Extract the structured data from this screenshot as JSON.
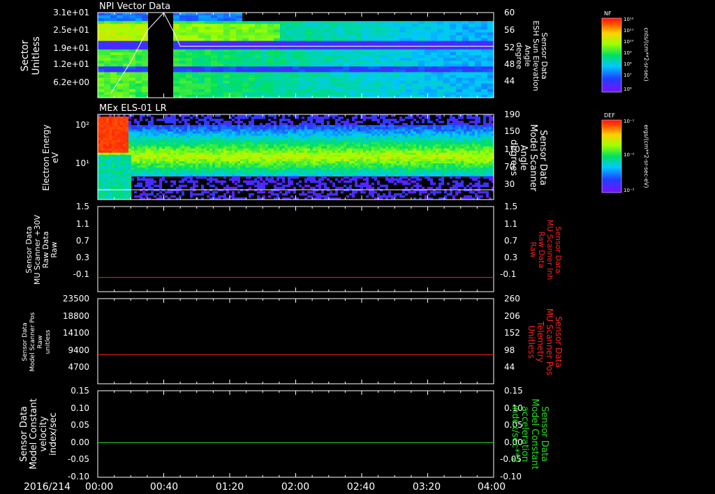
{
  "date_label": "2016/214",
  "time_ticks": [
    "00:00",
    "00:40",
    "01:20",
    "02:00",
    "02:40",
    "03:20",
    "04:00"
  ],
  "colors": {
    "background": "#000000",
    "axis": "#ffffff",
    "red_trace": "#ff2020",
    "green_trace": "#20e020",
    "red_label": "#ff2020",
    "green_label": "#20e020"
  },
  "panels": [
    {
      "title": "NPI Vector Data",
      "left_label": [
        "Sector",
        "Unitless"
      ],
      "left_ticks": [
        "3.1e+01",
        "2.5e+01",
        "1.9e+01",
        "1.2e+01",
        "6.2e+00"
      ],
      "right_label": [
        "Sensor Data",
        "ESH Sun Elevation",
        "Angle",
        "degree"
      ],
      "right_ticks": [
        "60",
        "56",
        "52",
        "48",
        "44"
      ],
      "colorbar": {
        "title": "NF",
        "label": "cnts/(cm**2-sr-sec)",
        "ticks": [
          "10¹²",
          "10¹¹",
          "10¹⁰",
          "10⁹",
          "10⁸",
          "10⁷",
          "10⁶"
        ]
      }
    },
    {
      "title": "MEx ELS-01 LR",
      "left_label": [
        "Electron Energy",
        "eV"
      ],
      "left_ticks": [
        "10²",
        "10¹"
      ],
      "right_label": [
        "Sensor Data",
        "Model Scanner",
        "Angle",
        "degrees"
      ],
      "right_ticks": [
        "190",
        "150",
        "110",
        "70",
        "30"
      ],
      "colorbar": {
        "title": "DEF",
        "label": "ergs/(cm**2-sr-sec-eV)",
        "ticks": [
          "10⁻¹",
          "10⁻²",
          "10⁻³"
        ]
      }
    },
    {
      "left_label": [
        "Sensor Data",
        "MU Scanner +30V",
        "Raw Data",
        "Raw"
      ],
      "left_ticks": [
        "1.5",
        "1.1",
        "0.7",
        "0.3",
        "-0.1"
      ],
      "right_label": [
        "Sensor Data",
        "MU Scanner Inh",
        "Raw Data",
        "Raw"
      ],
      "right_ticks": [
        "1.5",
        "1.1",
        "0.7",
        "0.3",
        "-0.1"
      ]
    },
    {
      "left_label": [
        "Sensor Data",
        "Model Scanner Pos",
        "Raw",
        "unitless"
      ],
      "left_ticks": [
        "23500",
        "18800",
        "14100",
        "9400",
        "4700"
      ],
      "right_label": [
        "Sensor Data",
        "MU Scanner Pos",
        "Telemetry",
        "Unitless"
      ],
      "right_ticks": [
        "260",
        "206",
        "152",
        "98",
        "44"
      ]
    },
    {
      "left_label": [
        "Sensor Data",
        "Model Constant",
        "velocity",
        "index/sec"
      ],
      "left_ticks": [
        "0.15",
        "0.10",
        "0.05",
        "0.00",
        "-0.05",
        "-0.10"
      ],
      "right_label": [
        "Sensor Data",
        "Model Constant",
        "acceleration",
        "index/sec**2"
      ],
      "right_ticks": [
        "0.15",
        "0.10",
        "0.05",
        "0.00",
        "-0.05",
        "-0.10"
      ]
    }
  ],
  "chart_data": [
    {
      "type": "heatmap",
      "title": "NPI Vector Data",
      "x_range": [
        "00:00",
        "04:00"
      ],
      "ylabel": "Sector Unitless",
      "ylim": [
        0,
        31
      ],
      "y2label": "Sensor Data ESH Sun Elevation Angle degree",
      "y2lim": [
        41,
        60
      ],
      "gap": {
        "start": "00:32",
        "end": "00:47"
      },
      "sun_elevation_series": {
        "x": [
          "00:08",
          "00:20",
          "00:30",
          "00:40",
          "00:47",
          "00:50",
          "04:00"
        ],
        "y": [
          42,
          49,
          56,
          60,
          55,
          52.5,
          52.5
        ]
      }
    },
    {
      "type": "heatmap",
      "title": "MEx ELS-01 LR",
      "x_range": [
        "00:00",
        "04:00"
      ],
      "ylabel": "Electron Energy eV",
      "yscale": "log",
      "y2label": "Sensor Data Model Scanner Angle degrees",
      "y2lim": [
        0,
        190
      ],
      "scanner_angle_series": {
        "x": [
          "00:00",
          "04:00"
        ],
        "y": [
          15,
          15
        ]
      }
    },
    {
      "type": "line",
      "x_range": [
        "00:00",
        "04:00"
      ],
      "ylim": [
        -0.3,
        1.5
      ],
      "series": [
        {
          "x": [
            "00:00",
            "04:00"
          ],
          "y": [
            0.0,
            0.0
          ]
        }
      ]
    },
    {
      "type": "line",
      "x_range": [
        "00:00",
        "04:00"
      ],
      "ylim": [
        0,
        23500
      ],
      "series": [
        {
          "x": [
            "00:00",
            "04:00"
          ],
          "y": [
            8000,
            8000
          ]
        }
      ]
    },
    {
      "type": "line",
      "x_range": [
        "00:00",
        "04:00"
      ],
      "ylim": [
        -0.1,
        0.15
      ],
      "series": [
        {
          "x": [
            "00:00",
            "04:00"
          ],
          "y": [
            0.0,
            0.0
          ]
        }
      ]
    }
  ]
}
